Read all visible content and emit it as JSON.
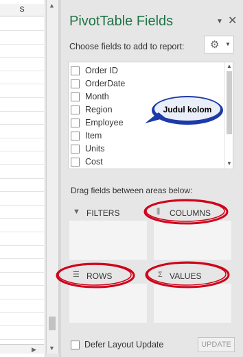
{
  "sheet": {
    "column_header": "S"
  },
  "panel": {
    "title": "PivotTable Fields",
    "choose_label": "Choose fields to add to report:",
    "fields": [
      "Order ID",
      "OrderDate",
      "Month",
      "Region",
      "Employee",
      "Item",
      "Units",
      "Cost"
    ],
    "callout": "Judul kolom",
    "drag_label": "Drag fields between areas below:",
    "areas": {
      "filters": "FILTERS",
      "columns": "COLUMNS",
      "rows": "ROWS",
      "values": "VALUES"
    },
    "defer_label": "Defer Layout Update",
    "update_label": "UPDATE"
  },
  "icons": {
    "settings": "gear-icon",
    "close": "close-icon",
    "pin": "pin-dropdown-icon"
  },
  "colors": {
    "title": "#217346",
    "annotation": "#d0021b",
    "callout_fill": "#1d3aa8"
  }
}
